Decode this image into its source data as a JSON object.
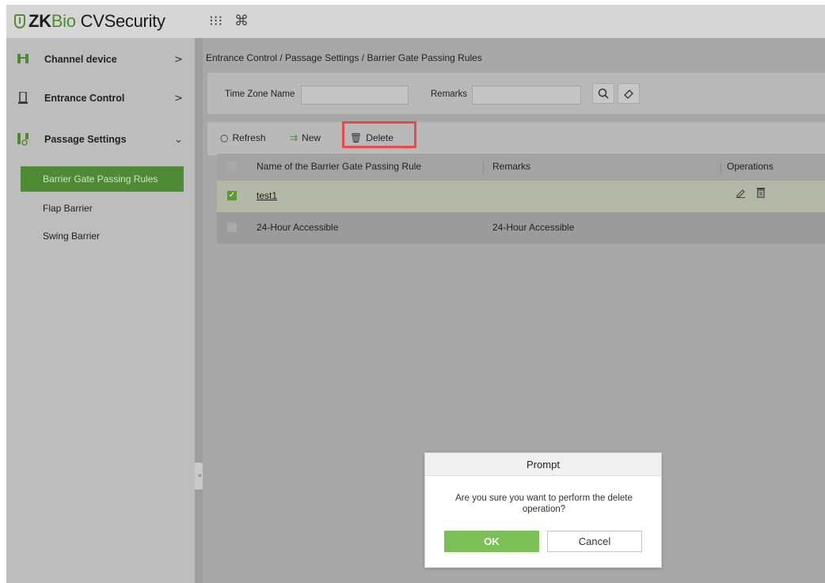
{
  "app": {
    "logo_zk": "ZK",
    "logo_bio": "Bio",
    "logo_rest": "CVSecurity",
    "apps_icon": "apps-grid-icon",
    "cmd_icon": "command-icon"
  },
  "sidebar": {
    "menus": [
      {
        "label": "Channel device",
        "icon": "channel-device-icon",
        "chevron": ">"
      },
      {
        "label": "Entrance Control",
        "icon": "entrance-control-icon",
        "chevron": ">"
      },
      {
        "label": "Passage Settings",
        "icon": "passage-settings-icon",
        "chevron": "⌄"
      }
    ],
    "sub_items": [
      {
        "label": "Barrier Gate Passing Rules",
        "active": true
      },
      {
        "label": "Flap Barrier",
        "active": false
      },
      {
        "label": "Swing Barrier",
        "active": false
      }
    ],
    "collapse_glyph": "«"
  },
  "breadcrumb": "Entrance Control / Passage Settings / Barrier Gate Passing Rules",
  "search": {
    "time_zone_label": "Time Zone Name",
    "time_zone_value": "",
    "remarks_label": "Remarks",
    "remarks_value": ""
  },
  "toolbar": {
    "refresh": "Refresh",
    "new": "New",
    "delete": "Delete"
  },
  "table": {
    "headers": {
      "name": "Name of the Barrier Gate Passing Rule",
      "remarks": "Remarks",
      "operations": "Operations"
    },
    "rows": [
      {
        "name": "test1",
        "remarks": "",
        "checked": true
      },
      {
        "name": "24-Hour Accessible",
        "remarks": "24-Hour Accessible",
        "checked": false
      }
    ]
  },
  "dialog": {
    "title": "Prompt",
    "message": "Are you sure you want to perform the delete operation?",
    "ok": "OK",
    "cancel": "Cancel"
  },
  "colors": {
    "accent_green": "#4f8a35",
    "ok_button": "#7ac057",
    "highlight_red": "#e84a4a"
  }
}
